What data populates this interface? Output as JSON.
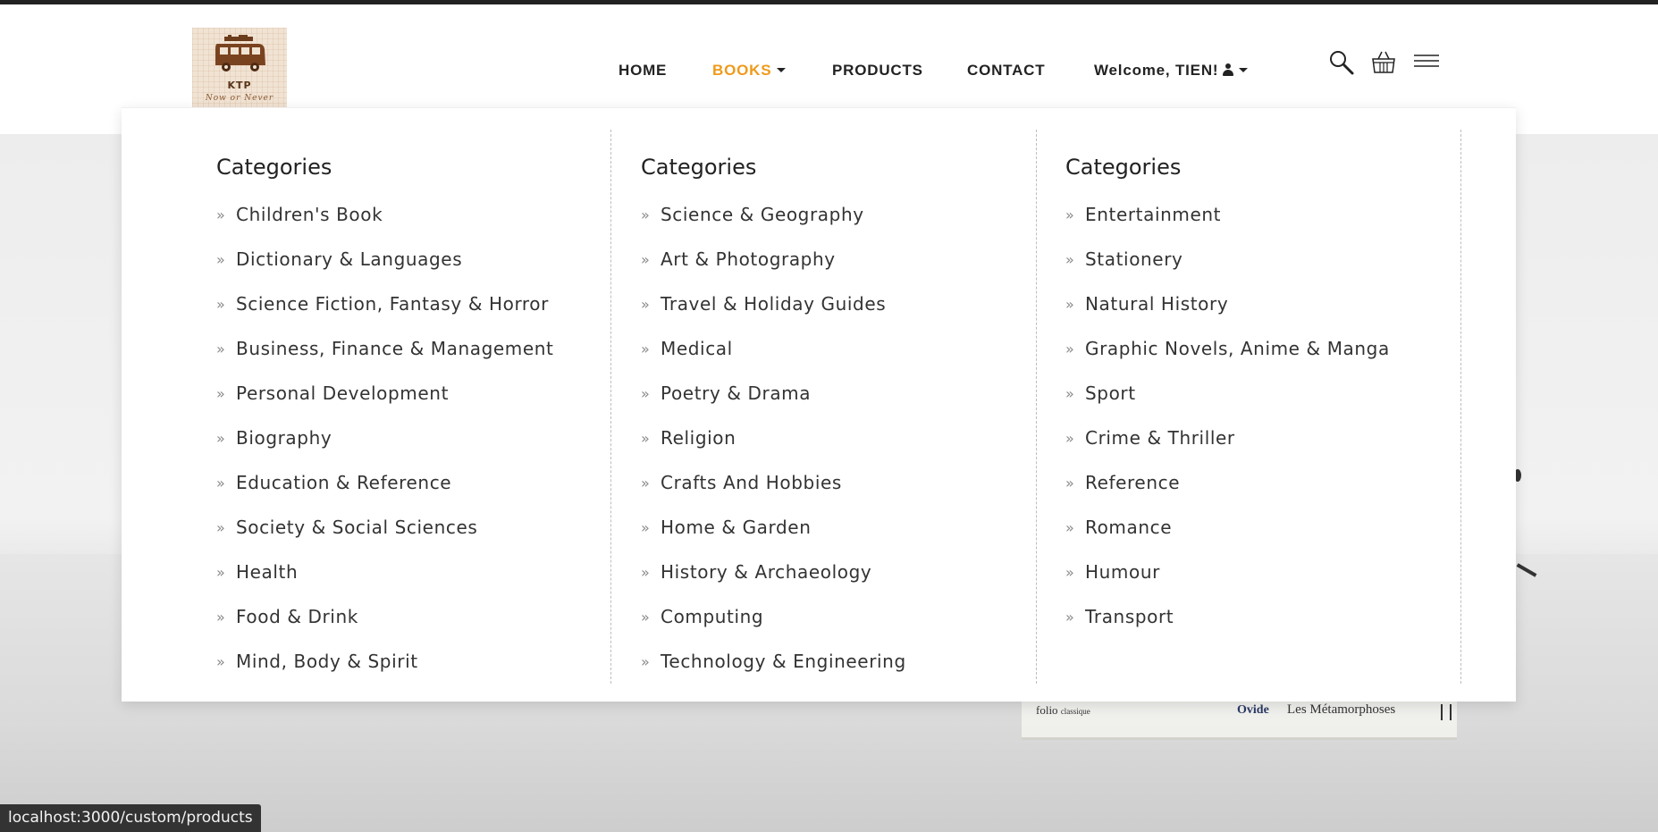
{
  "brand": {
    "name": "KTP",
    "tagline": "Now or Never"
  },
  "nav": {
    "items": [
      {
        "label": "HOME",
        "active": false
      },
      {
        "label": "BOOKS",
        "active": true
      },
      {
        "label": "PRODUCTS",
        "active": false
      },
      {
        "label": "CONTACT",
        "active": false
      }
    ],
    "welcome": "Welcome, TIEN!",
    "active_color": "#ef9a1a"
  },
  "icons": {
    "search": "search-icon",
    "cart": "basket-icon",
    "menu": "hamburger-icon"
  },
  "dropdown": {
    "columns": [
      {
        "title": "Categories",
        "items": [
          "Children's Book",
          "Dictionary & Languages",
          "Science Fiction, Fantasy & Horror",
          "Business, Finance & Management",
          "Personal Development",
          "Biography",
          "Education & Reference",
          "Society & Social Sciences",
          "Health",
          "Food & Drink",
          "Mind, Body & Spirit"
        ]
      },
      {
        "title": "Categories",
        "items": [
          "Science & Geography",
          "Art & Photography",
          "Travel & Holiday Guides",
          "Medical",
          "Poetry & Drama",
          "Religion",
          "Crafts And Hobbies",
          "Home & Garden",
          "History & Archaeology",
          "Computing",
          "Technology & Engineering"
        ]
      },
      {
        "title": "Categories",
        "items": [
          "Entertainment",
          "Stationery",
          "Natural History",
          "Graphic Novels, Anime & Manga",
          "Sport",
          "Crime & Thriller",
          "Reference",
          "Romance",
          "Humour",
          "Transport"
        ]
      }
    ]
  },
  "hero_book": {
    "publisher": "folio",
    "series": "classique",
    "author": "Ovide",
    "title": "Les Métamorphoses"
  },
  "status_url": "localhost:3000/custom/products"
}
